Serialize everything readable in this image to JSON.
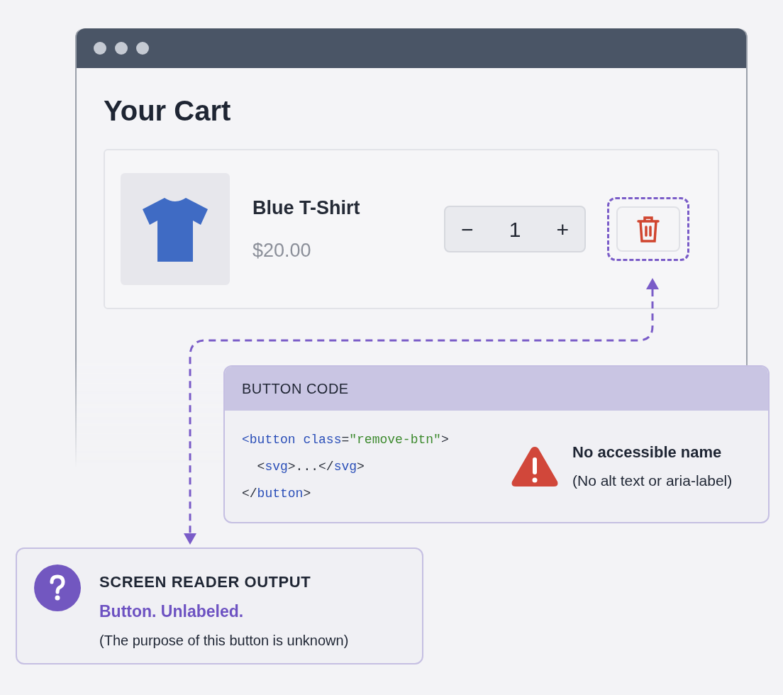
{
  "window": {
    "page_title": "Your Cart"
  },
  "cart_item": {
    "name": "Blue T-Shirt",
    "price": "$20.00",
    "decrement": "−",
    "quantity": "1",
    "increment": "+",
    "highlighted": true
  },
  "code_panel": {
    "title": "BUTTON CODE",
    "lines": [
      [
        {
          "text": "<button ",
          "kind": "tag"
        },
        {
          "text": "class",
          "kind": "attr"
        },
        {
          "text": "=",
          "kind": "punct"
        },
        {
          "text": "\"remove-btn\"",
          "kind": "string"
        },
        {
          "text": ">",
          "kind": "punct"
        }
      ],
      [
        {
          "text": "  <",
          "kind": "punct"
        },
        {
          "text": "svg",
          "kind": "tag"
        },
        {
          "text": ">...</",
          "kind": "punct"
        },
        {
          "text": "svg",
          "kind": "tag"
        },
        {
          "text": ">",
          "kind": "punct"
        }
      ],
      [
        {
          "text": "</",
          "kind": "punct"
        },
        {
          "text": "button",
          "kind": "tag"
        },
        {
          "text": ">",
          "kind": "punct"
        }
      ]
    ],
    "warning_title": "No accessible name",
    "warning_detail": "(No alt text or aria-label)"
  },
  "screen_reader": {
    "title": "SCREEN READER OUTPUT",
    "output": "Button. Unlabeled.",
    "note": "(The purpose of this button is unknown)"
  }
}
